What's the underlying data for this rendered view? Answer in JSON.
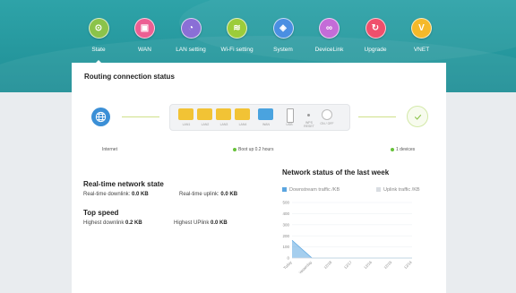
{
  "nav": {
    "items": [
      {
        "label": "State",
        "icon": "router-icon",
        "color": "#8bc34a",
        "glyph": "⊙"
      },
      {
        "label": "WAN",
        "icon": "wan-icon",
        "color": "#ec5f93",
        "glyph": "▣"
      },
      {
        "label": "LAN setting",
        "icon": "lan-icon",
        "color": "#8a6fd6",
        "glyph": "◔"
      },
      {
        "label": "Wi-Fi setting",
        "icon": "wifi-icon",
        "color": "#9ccc3a",
        "glyph": "≋"
      },
      {
        "label": "System",
        "icon": "shield-icon",
        "color": "#4a8fe2",
        "glyph": "◈"
      },
      {
        "label": "DeviceLink",
        "icon": "link-icon",
        "color": "#c46cd8",
        "glyph": "∞"
      },
      {
        "label": "Upgrade",
        "icon": "refresh-icon",
        "color": "#ef4f6c",
        "glyph": "↻"
      },
      {
        "label": "VNET",
        "icon": "vnet-icon",
        "color": "#f5b92a",
        "glyph": "V"
      }
    ],
    "active": "State"
  },
  "routing": {
    "title": "Routing connection status",
    "internet_label": "Internet",
    "uptime": "Boot up 0.2 hours",
    "devices": "1 devices",
    "ports": [
      "LAN1",
      "LAN2",
      "LAN3",
      "LAN4",
      "WAN"
    ],
    "usb_label": "USB",
    "wps_label": "WPS RESET",
    "pwr_label": "ON / OFF"
  },
  "realtime": {
    "title": "Real-time network state",
    "downlink_label": "Real-time downlink:",
    "downlink_value": "0.0 KB",
    "uplink_label": "Real-time uplink:",
    "uplink_value": "0.0 KB"
  },
  "topspeed": {
    "title": "Top speed",
    "downlink_label": "Highest downlink",
    "downlink_value": "0.2 KB",
    "uplink_label": "Highest UPlink",
    "uplink_value": "0.0 KB"
  },
  "weekly": {
    "title": "Network status of the last week",
    "legend_down": "Downstream traffic  /KB",
    "legend_up": "Uplink traffic  /KB",
    "down_color": "#5ba6e0",
    "up_color": "#d9dde2"
  },
  "chart_data": {
    "type": "area",
    "title": "Network status of the last week",
    "categories": [
      "Today",
      "Yesterday",
      "12/18",
      "12/17",
      "12/16",
      "12/15",
      "12/14"
    ],
    "series": [
      {
        "name": "Downstream traffic  /KB",
        "values": [
          160,
          0,
          0,
          0,
          0,
          0,
          0
        ]
      },
      {
        "name": "Uplink traffic  /KB",
        "values": [
          0,
          0,
          0,
          0,
          0,
          0,
          0
        ]
      }
    ],
    "yticks": [
      0,
      100,
      200,
      300,
      400,
      500
    ],
    "ylim": [
      0,
      500
    ],
    "grid": true,
    "legend": "top"
  }
}
